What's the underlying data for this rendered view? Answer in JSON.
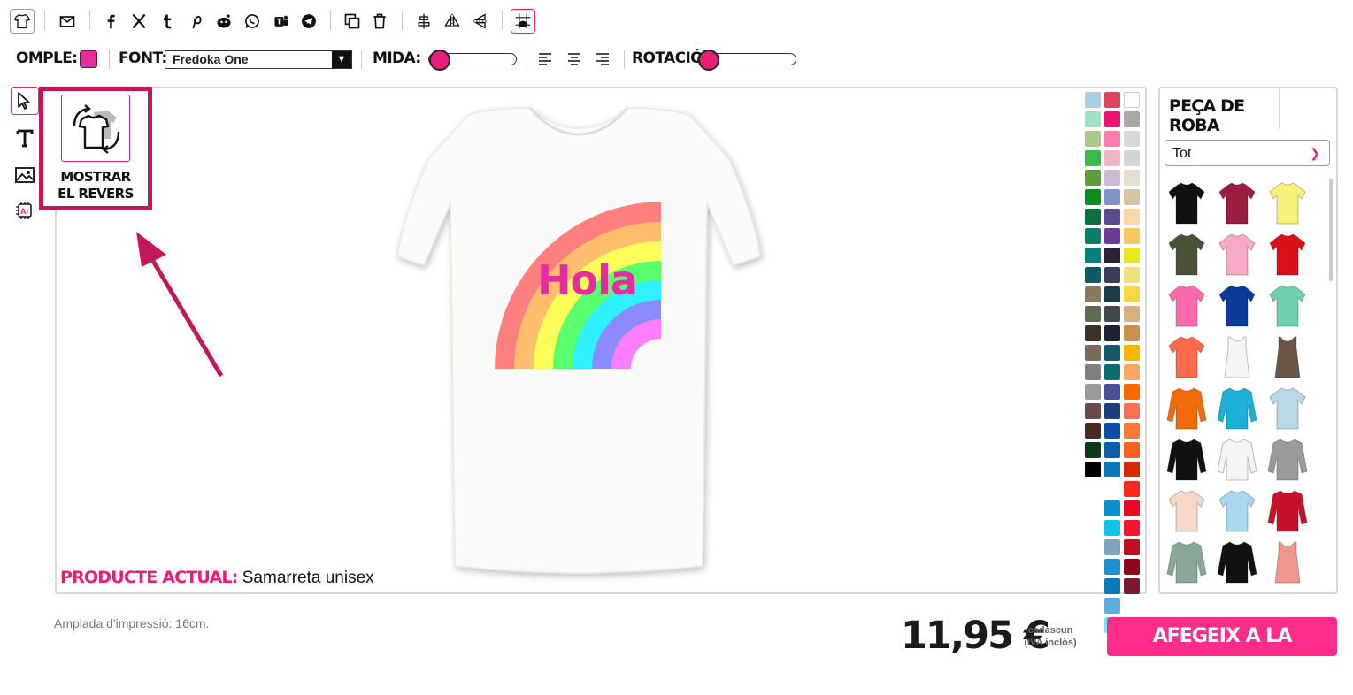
{
  "toolbar": {
    "icons": [
      "tshirt-icon",
      "email-icon",
      "facebook-icon",
      "x-icon",
      "tumblr-icon",
      "pinterest-icon",
      "reddit-icon",
      "whatsapp-icon",
      "teams-icon",
      "telegram-icon",
      "duplicate-icon",
      "trash-icon",
      "align-center-icon",
      "flip-horizontal-icon",
      "flip-vertical-icon",
      "snap-grid-icon"
    ]
  },
  "props": {
    "fill_label": "OMPLE:",
    "fill_color": "#e62da0",
    "font_label": "FONT:",
    "font_value": "Fredoka One",
    "size_label": "MIDA:",
    "size_level": 0,
    "rotation_label": "ROTACIÓ:",
    "rotation_level": 0
  },
  "reverse": {
    "label_line1": "MOSTRAR",
    "label_line2": "EL REVERS"
  },
  "design": {
    "text": "Hola",
    "text_color": "#e62da0"
  },
  "current_product": {
    "label": "PRODUCTE ACTUAL:",
    "value": "Samarreta unisex"
  },
  "palette": {
    "col1": [
      "#a9cde3",
      "#9fe0c3",
      "#a9c98a",
      "#38b94a",
      "#5e9c3a",
      "#0f8a1c",
      "#0c6e3e",
      "#0a7b6c",
      "#0b7c80",
      "#0f5a62",
      "#8a7a62",
      "#5b6e52",
      "#3d3228",
      "#7a6a5a",
      "#808080",
      "#9a9a9a",
      "#6b4a4a",
      "#4a2a22",
      "#0d3a1a",
      "#000000"
    ],
    "col2": [
      "#d9435b",
      "#e8156a",
      "#ff7ab0",
      "#f0b3c8",
      "#cfb7d6",
      "#7f95c9",
      "#5a4b8e",
      "#6b3a9a",
      "#2b2238",
      "#3a3e5c",
      "#1f3a4a",
      "#3f4b4a",
      "#1a2434",
      "#16586a",
      "#0a6c6c",
      "#4b4e99",
      "#1a3f7a",
      "#0a4fa8",
      "#0b5ea8",
      "#0a78b8",
      "#0a90d0",
      "#12c3e8",
      "#7fa3b8",
      "#1f8fd0",
      "#0a7ab8",
      "#5aaed8",
      "#6ee8ee"
    ],
    "col3": [
      "#ffffff",
      "#a8a8a8",
      "#d8d8d8",
      "#d4d4d4",
      "#e4dfcf",
      "#d8c3a2",
      "#f8d8a8",
      "#f8c860",
      "#e8e820",
      "#f0e080",
      "#f8d840",
      "#d8b080",
      "#c8904a",
      "#f8b800",
      "#f8a860",
      "#f86a00",
      "#f87050",
      "#f87838",
      "#f86020",
      "#d82a00",
      "#f82a20",
      "#e80820",
      "#f01830",
      "#c01020",
      "#8a0818",
      "#7a1a30"
    ]
  },
  "panel": {
    "tab": "PEÇA DE ROBA",
    "filter": "Tot",
    "products": [
      "black-tshirt-icon",
      "maroon-tshirt-icon",
      "yellow-tshirt-icon",
      "olive-tshirt-icon",
      "pink-womens-tshirt-icon",
      "red-tshirt-icon",
      "hotpink-womens-tshirt-icon",
      "royal-blue-tshirt-icon",
      "mint-tshirt-icon",
      "coral-womens-tshirt-icon",
      "white-tanktop-icon",
      "brown-tanktop-icon",
      "orange-hoodie-icon",
      "turquoise-hoodie-icon",
      "tiedye-tshirt-icon",
      "black-longsleeve-icon",
      "raglan-black-white-icon",
      "grey-hoodie-icon",
      "peach-tshirt-icon",
      "gradient-blue-tshirt-icon",
      "varsity-jacket-icon",
      "sage-longsleeve-icon",
      "black-orange-hoodie-icon",
      "salmon-tanktop-icon"
    ]
  },
  "footer": {
    "print_width": "Amplada d'impressió: 16cm.",
    "price": "11,95 €",
    "price_note1": "cadascun",
    "price_note2": "(IVA inclòs)",
    "add_cart": "AFEGEIX A LA CISTELLA"
  }
}
